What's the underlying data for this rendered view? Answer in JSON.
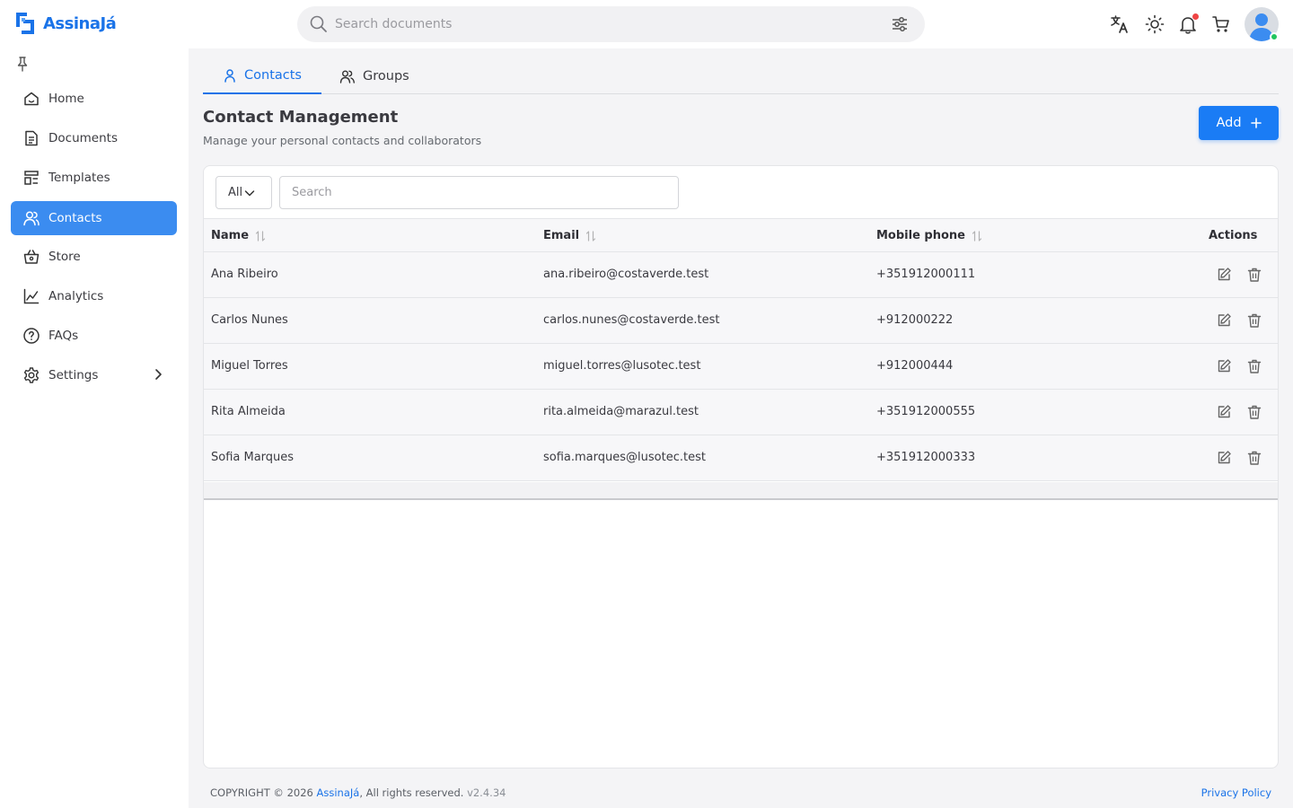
{
  "app": {
    "name": "AssinaJá"
  },
  "header": {
    "search_placeholder": "Search documents",
    "icons": [
      "translate-icon",
      "sun-icon",
      "bell-icon",
      "cart-icon"
    ],
    "has_notification": true
  },
  "sidebar": {
    "items": [
      {
        "label": "Home",
        "icon": "home-icon"
      },
      {
        "label": "Documents",
        "icon": "document-icon"
      },
      {
        "label": "Templates",
        "icon": "template-icon"
      },
      {
        "label": "Contacts",
        "icon": "users-icon",
        "active": true
      },
      {
        "label": "Store",
        "icon": "basket-icon"
      },
      {
        "label": "Analytics",
        "icon": "chart-icon"
      },
      {
        "label": "FAQs",
        "icon": "help-icon"
      },
      {
        "label": "Settings",
        "icon": "gear-icon",
        "has_submenu": true
      }
    ]
  },
  "tabs": [
    {
      "label": "Contacts",
      "icon": "user-icon",
      "active": true
    },
    {
      "label": "Groups",
      "icon": "users-icon",
      "active": false
    }
  ],
  "page": {
    "title": "Contact Management",
    "subtitle": "Manage your personal contacts and collaborators",
    "add_label": "Add"
  },
  "filters": {
    "selected": "All",
    "search_placeholder": "Search"
  },
  "table": {
    "columns": [
      "Name",
      "Email",
      "Mobile phone",
      "Actions"
    ],
    "rows": [
      {
        "name": "Ana Ribeiro",
        "email": "ana.ribeiro@costaverde.test",
        "phone": "+351912000111"
      },
      {
        "name": "Carlos Nunes",
        "email": "carlos.nunes@costaverde.test",
        "phone": "+912000222"
      },
      {
        "name": "Miguel Torres",
        "email": "miguel.torres@lusotec.test",
        "phone": "+912000444"
      },
      {
        "name": "Rita Almeida",
        "email": "rita.almeida@marazul.test",
        "phone": "+351912000555"
      },
      {
        "name": "Sofia Marques",
        "email": "sofia.marques@lusotec.test",
        "phone": "+351912000333"
      }
    ]
  },
  "footer": {
    "copyright_prefix": "COPYRIGHT © 2026 ",
    "brand": "AssinaJá",
    "suffix": ", All rights reserved.",
    "version": "v2.4.34",
    "privacy": "Privacy Policy"
  },
  "colors": {
    "accent": "#1a73e8",
    "active_nav": "#3b8cf0",
    "add_button": "#1a7cf5",
    "notification": "#ef4444",
    "online": "#22c55e"
  }
}
